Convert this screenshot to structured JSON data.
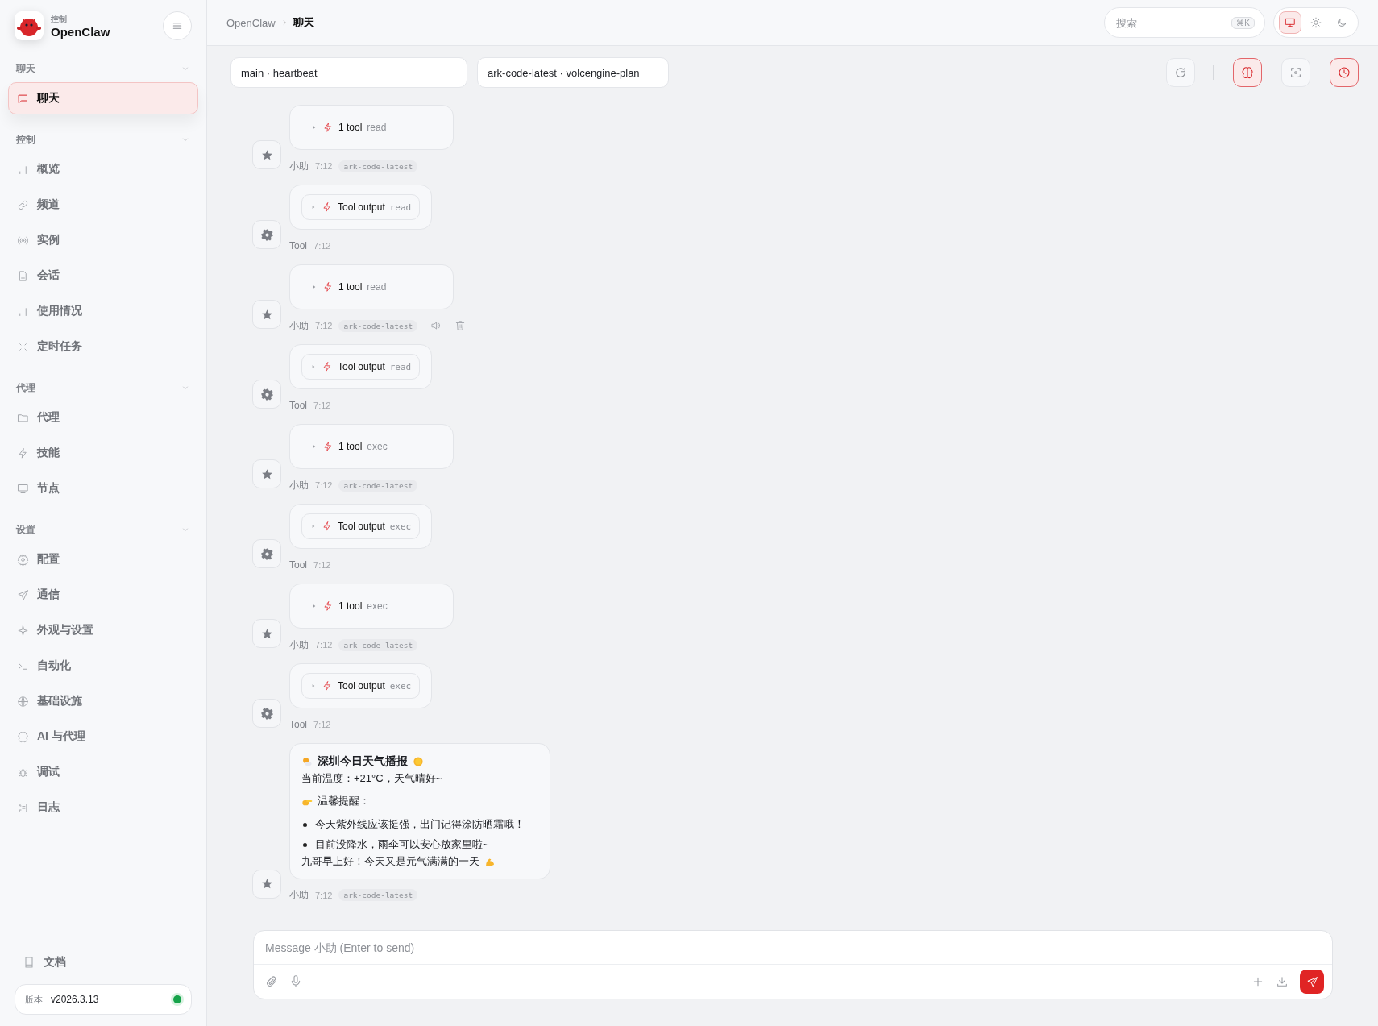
{
  "sidebar": {
    "brand": {
      "caption": "控制",
      "name": "OpenClaw"
    },
    "groups": [
      {
        "label": "聊天",
        "expanded": true,
        "items": [
          {
            "label": "聊天",
            "selected": true
          }
        ]
      },
      {
        "label": "控制",
        "expanded": true,
        "items": [
          {
            "label": "概览",
            "selected": false
          },
          {
            "label": "频道",
            "selected": false
          },
          {
            "label": "实例",
            "selected": false
          },
          {
            "label": "会话",
            "selected": false
          },
          {
            "label": "使用情况",
            "selected": false
          },
          {
            "label": "定时任务",
            "selected": false
          }
        ]
      },
      {
        "label": "代理",
        "expanded": true,
        "items": [
          {
            "label": "代理",
            "selected": false
          },
          {
            "label": "技能",
            "selected": false
          },
          {
            "label": "节点",
            "selected": false
          }
        ]
      },
      {
        "label": "设置",
        "expanded": true,
        "items": [
          {
            "label": "配置",
            "selected": false
          },
          {
            "label": "通信",
            "selected": false
          },
          {
            "label": "外观与设置",
            "selected": false
          },
          {
            "label": "自动化",
            "selected": false
          },
          {
            "label": "基础设施",
            "selected": false
          },
          {
            "label": "AI 与代理",
            "selected": false
          },
          {
            "label": "调试",
            "selected": false
          },
          {
            "label": "日志",
            "selected": false
          }
        ]
      }
    ],
    "docs_link": "文档",
    "version": {
      "label": "版本",
      "value": "v2026.3.13",
      "online": true
    }
  },
  "header": {
    "breadcrumb": [
      "OpenClaw",
      "聊天"
    ],
    "search": {
      "placeholder": "搜索",
      "shortcut": "⌘K"
    },
    "theme_modes": [
      {
        "selected": true
      },
      {
        "selected": false
      },
      {
        "selected": false
      }
    ]
  },
  "session_bar": {
    "session": "main · heartbeat",
    "model": "ark-code-latest · volcengine-plan",
    "tools": [
      {
        "active": false
      },
      {
        "active": true
      },
      {
        "active": false
      },
      {
        "active": true
      }
    ]
  },
  "messages": [
    {
      "kind": "tool_call",
      "summary": "1 tool",
      "tool": "read",
      "sender": "小助",
      "time": "7:12",
      "model": "ark-code-latest",
      "actions_visible": false
    },
    {
      "kind": "tool_output",
      "summary": "Tool output",
      "tool": "read",
      "sender": "Tool",
      "time": "7:12",
      "actions_visible": false
    },
    {
      "kind": "tool_call",
      "summary": "1 tool",
      "tool": "read",
      "sender": "小助",
      "time": "7:12",
      "model": "ark-code-latest",
      "actions_visible": true
    },
    {
      "kind": "tool_output",
      "summary": "Tool output",
      "tool": "read",
      "sender": "Tool",
      "time": "7:12",
      "actions_visible": false
    },
    {
      "kind": "tool_call",
      "summary": "1 tool",
      "tool": "exec",
      "sender": "小助",
      "time": "7:12",
      "model": "ark-code-latest",
      "actions_visible": false
    },
    {
      "kind": "tool_output",
      "summary": "Tool output",
      "tool": "exec",
      "sender": "Tool",
      "time": "7:12",
      "actions_visible": false
    },
    {
      "kind": "tool_call",
      "summary": "1 tool",
      "tool": "exec",
      "sender": "小助",
      "time": "7:12",
      "model": "ark-code-latest",
      "actions_visible": false
    },
    {
      "kind": "tool_output",
      "summary": "Tool output",
      "tool": "exec",
      "sender": "Tool",
      "time": "7:12",
      "actions_visible": false
    },
    {
      "kind": "text",
      "sender": "小助",
      "time": "7:12",
      "model": "ark-code-latest",
      "actions_visible": false,
      "blocks": [
        {
          "kind": "heading",
          "text": "深圳今日天气播报"
        },
        {
          "kind": "paragraph",
          "text": "当前温度：+21°C，天气晴好~"
        },
        {
          "kind": "callout",
          "text": "温馨提醒："
        },
        {
          "kind": "bullet",
          "text": "今天紫外线应该挺强，出门记得涂防晒霜哦！"
        },
        {
          "kind": "bullet",
          "text": "目前没降水，雨伞可以安心放家里啦~"
        },
        {
          "kind": "closing",
          "text": "九哥早上好！今天又是元气满满的一天"
        }
      ]
    }
  ],
  "composer": {
    "placeholder": "Message 小助 (Enter to send)"
  }
}
